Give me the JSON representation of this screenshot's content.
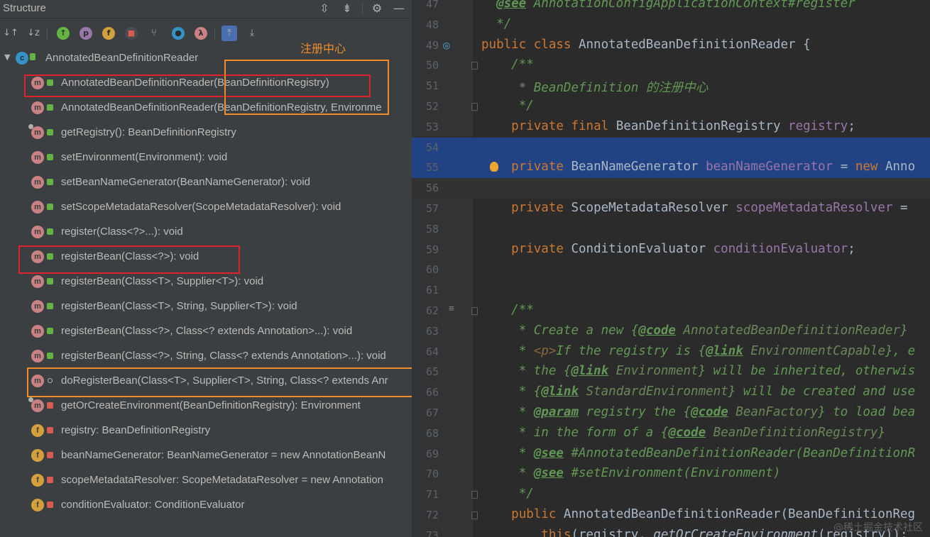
{
  "structure": {
    "title": "Structure",
    "header_icons": [
      "expand-all-icon",
      "collapse-all-icon",
      "gear-icon",
      "minimize-icon"
    ],
    "toolbar_icons": [
      "sort-by-visibility-icon",
      "sort-alphabetically-icon",
      "show-inherited-icon",
      "show-properties-icon",
      "show-fields-icon",
      "show-non-public-icon",
      "show-anonymous-icon",
      "show-lambdas-icon",
      "show-lambdas2-icon",
      "autoscroll-to-source-icon",
      "autoscroll-from-source-icon"
    ],
    "root": {
      "icon_letter": "c",
      "name": "AnnotatedBeanDefinitionReader"
    },
    "annotation_text": "注册中心",
    "members": [
      {
        "kind": "method",
        "letter": "m",
        "visibility": "public",
        "label": "AnnotatedBeanDefinitionReader(BeanDefinitionRegistry)"
      },
      {
        "kind": "method",
        "letter": "m",
        "visibility": "public",
        "label": "AnnotatedBeanDefinitionReader(BeanDefinitionRegistry, Environme"
      },
      {
        "kind": "method",
        "letter": "m",
        "visibility": "public",
        "label": "getRegistry(): BeanDefinitionRegistry",
        "override": true
      },
      {
        "kind": "method",
        "letter": "m",
        "visibility": "public",
        "label": "setEnvironment(Environment): void"
      },
      {
        "kind": "method",
        "letter": "m",
        "visibility": "public",
        "label": "setBeanNameGenerator(BeanNameGenerator): void"
      },
      {
        "kind": "method",
        "letter": "m",
        "visibility": "public",
        "label": "setScopeMetadataResolver(ScopeMetadataResolver): void"
      },
      {
        "kind": "method",
        "letter": "m",
        "visibility": "public",
        "label": "register(Class<?>...): void"
      },
      {
        "kind": "method",
        "letter": "m",
        "visibility": "public",
        "label": "registerBean(Class<?>): void"
      },
      {
        "kind": "method",
        "letter": "m",
        "visibility": "public",
        "label": "registerBean(Class<T>, Supplier<T>): void"
      },
      {
        "kind": "method",
        "letter": "m",
        "visibility": "public",
        "label": "registerBean(Class<T>, String, Supplier<T>): void"
      },
      {
        "kind": "method",
        "letter": "m",
        "visibility": "public",
        "label": "registerBean(Class<?>, Class<? extends Annotation>...): void"
      },
      {
        "kind": "method",
        "letter": "m",
        "visibility": "public",
        "label": "registerBean(Class<?>, String, Class<? extends Annotation>...): void"
      },
      {
        "kind": "method",
        "letter": "m",
        "visibility": "pkg",
        "label": "doRegisterBean(Class<T>, Supplier<T>, String, Class<? extends Anr"
      },
      {
        "kind": "method",
        "letter": "m",
        "visibility": "private",
        "label": "getOrCreateEnvironment(BeanDefinitionRegistry): Environment",
        "override": true
      },
      {
        "kind": "field",
        "letter": "f",
        "visibility": "private",
        "label": "registry: BeanDefinitionRegistry"
      },
      {
        "kind": "field",
        "letter": "f",
        "visibility": "private",
        "label": "beanNameGenerator: BeanNameGenerator = new AnnotationBeanN"
      },
      {
        "kind": "field",
        "letter": "f",
        "visibility": "private",
        "label": "scopeMetadataResolver: ScopeMetadataResolver = new Annotation"
      },
      {
        "kind": "field",
        "letter": "f",
        "visibility": "private",
        "label": "conditionEvaluator: ConditionEvaluator"
      }
    ]
  },
  "editor": {
    "lines": [
      {
        "n": "47",
        "text": "@see AnnotationConfigApplicationContext#register"
      },
      {
        "n": "48",
        "text": "*/"
      },
      {
        "n": "49",
        "text": "public class AnnotatedBeanDefinitionReader {"
      },
      {
        "n": "50",
        "text": "/**"
      },
      {
        "n": "51",
        "text": "* BeanDefinition 的注册中心"
      },
      {
        "n": "52",
        "text": "*/"
      },
      {
        "n": "53",
        "text": "private final BeanDefinitionRegistry registry;"
      },
      {
        "n": "54",
        "text": ""
      },
      {
        "n": "55",
        "text": "private BeanNameGenerator beanNameGenerator = new Anno"
      },
      {
        "n": "56",
        "text": ""
      },
      {
        "n": "57",
        "text": "private ScopeMetadataResolver scopeMetadataResolver ="
      },
      {
        "n": "58",
        "text": ""
      },
      {
        "n": "59",
        "text": "private ConditionEvaluator conditionEvaluator;"
      },
      {
        "n": "60",
        "text": ""
      },
      {
        "n": "61",
        "text": ""
      },
      {
        "n": "62",
        "text": "/**"
      },
      {
        "n": "63",
        "text": "* Create a new {@code AnnotatedBeanDefinitionReader}"
      },
      {
        "n": "64",
        "text": "* <p>If the registry is {@link EnvironmentCapable}, e"
      },
      {
        "n": "65",
        "text": "* the {@link Environment} will be inherited, otherwis"
      },
      {
        "n": "66",
        "text": "* {@link StandardEnvironment} will be created and use"
      },
      {
        "n": "67",
        "text": "* @param registry the {@code BeanFactory} to load bea"
      },
      {
        "n": "68",
        "text": "* in the form of a {@code BeanDefinitionRegistry}"
      },
      {
        "n": "69",
        "text": "* @see #AnnotatedBeanDefinitionReader(BeanDefinitionR"
      },
      {
        "n": "70",
        "text": "* @see #setEnvironment(Environment)"
      },
      {
        "n": "71",
        "text": "*/"
      },
      {
        "n": "72",
        "text": "public AnnotatedBeanDefinitionReader(BeanDefinitionReg"
      },
      {
        "n": "73",
        "text": "this(registry, getOrCreateEnvironment(registry));"
      }
    ],
    "watermark": "@稀土掘金技术社区"
  }
}
